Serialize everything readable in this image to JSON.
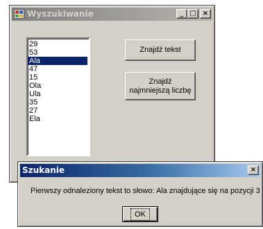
{
  "main_window": {
    "title": "Wyszukiwanie",
    "controls": {
      "minimize": "_",
      "maximize": "□",
      "close": "×"
    },
    "list_items": [
      "29",
      "53",
      "Ala",
      "47",
      "15",
      "Ola",
      "Ula",
      "35",
      "27",
      "Ela"
    ],
    "selected_index": 2,
    "find_text_button": "Znajdź tekst",
    "find_min_button_line1": "Znajdź",
    "find_min_button_line2": "najmniejszą liczbę"
  },
  "dialog": {
    "title": "Szukanie",
    "close": "×",
    "message": "Pierwszy odnaleziony tekst to słowo: Ala znajdujące się na pozycji 3",
    "ok_label": "OK"
  }
}
